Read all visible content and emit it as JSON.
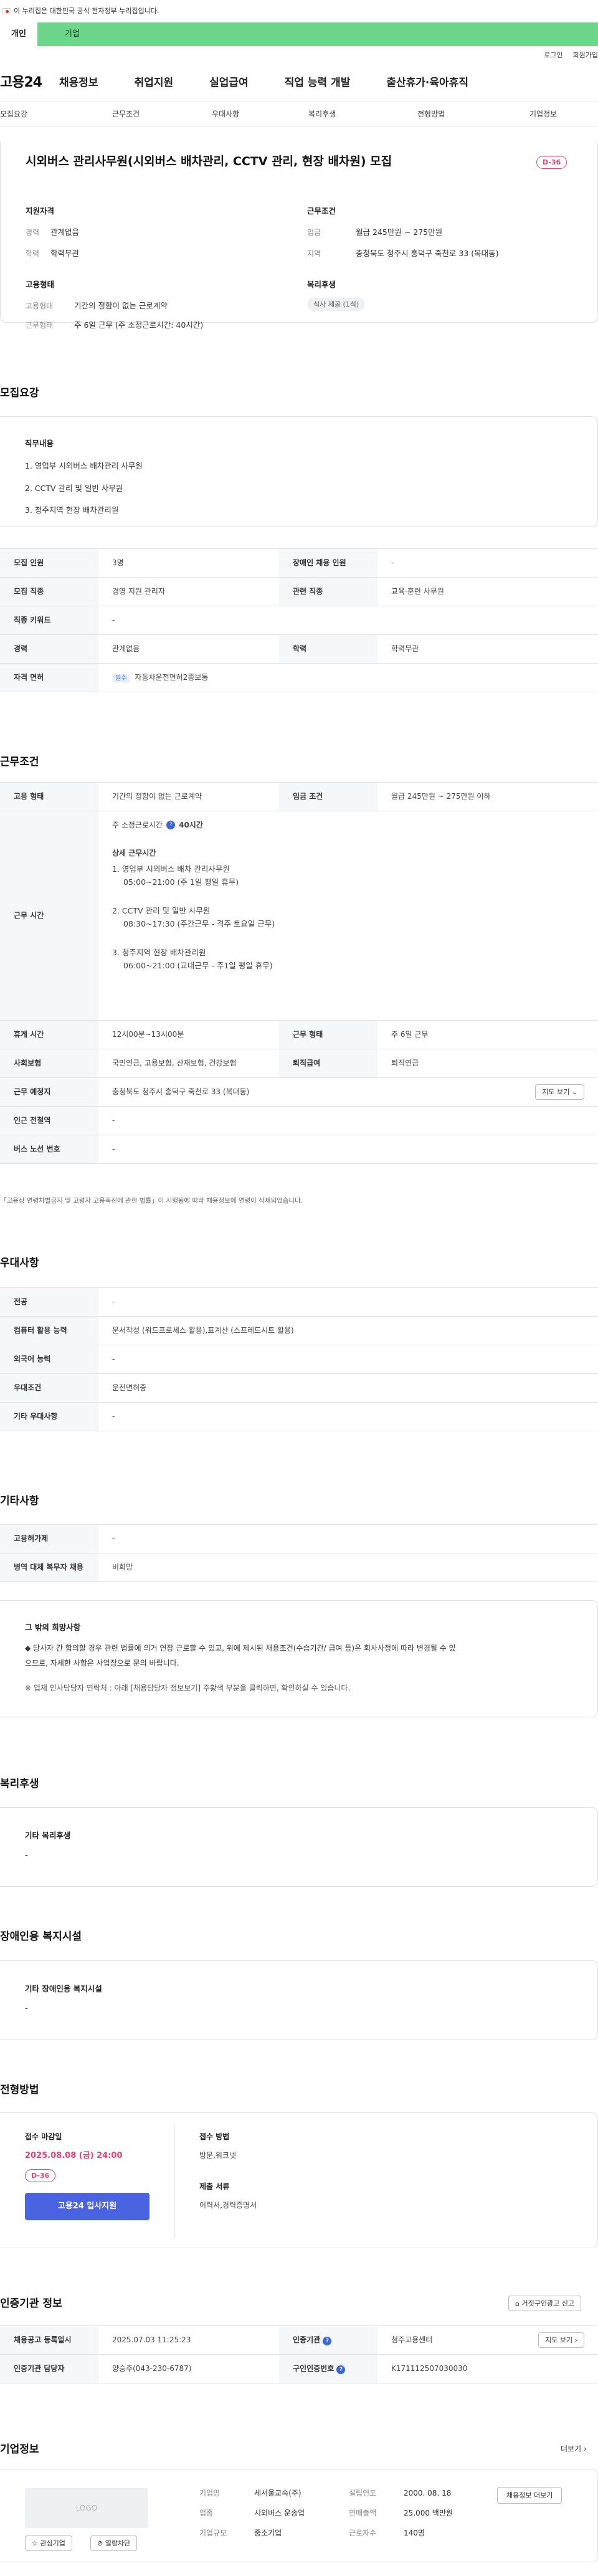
{
  "gov_banner": {
    "text": "이 누리집은 대한민국 공식 전자정부 누리집입니다."
  },
  "tabs": {
    "personal": "개인",
    "company": "기업"
  },
  "utility": {
    "login": "로그인",
    "join": "회원가입"
  },
  "gnb": {
    "logo": "고용24",
    "menu": [
      "채용정보",
      "취업지원",
      "실업급여",
      "직업 능력 개발",
      "출산휴가·육아휴직"
    ]
  },
  "anchors": [
    "모집요강",
    "근무조건",
    "우대사항",
    "복리후생",
    "전형방법",
    "기업정보"
  ],
  "summary": {
    "title": "시외버스 관리사무원(시외버스 배차관리, CCTV 관리, 현장 배차원) 모집",
    "dday": "D-36",
    "qual_head": "지원자격",
    "career_l": "경력",
    "career_v": "관계없음",
    "edu_l": "학력",
    "edu_v": "학력무관",
    "emp_head": "고용형태",
    "emp_l": "고용형태",
    "emp_v": "기간의 정함이 없는 근로계약",
    "work_l": "근무형태",
    "work_v": "주 6일 근무 (주 소정근로시간: 40시간)",
    "cond_head": "근무조건",
    "pay_l": "임금",
    "pay_v": "월급 245만원 ~ 275만원",
    "loc_l": "지역",
    "loc_v": "충청북도 청주시 흥덕구 죽천로 33 (복대동)",
    "welfare_head": "복리후생",
    "welfare_chip": "식사 제공 (1식)"
  },
  "recruit": {
    "title": "모집요강",
    "duty_head": "직무내용",
    "duties": [
      "1. 영업부 시외버스 배차관리 사무원",
      "2. CCTV 관리 및 일반 사무원",
      "3. 청주지역 현장 배차관리원"
    ],
    "rows": [
      {
        "k1": "모집 인원",
        "v1": "3명",
        "k2": "장애인 채용 인원",
        "v2": "-"
      },
      {
        "k1": "모집 직종",
        "v1": "경영 지원 관리자",
        "k2": "관련 직종",
        "v2": "교육·훈련 사무원"
      },
      {
        "k1": "직종 키워드",
        "v1": "-"
      },
      {
        "k1": "경력",
        "v1": "관계없음",
        "k2": "학력",
        "v2": "학력무관"
      },
      {
        "k1": "자격 면허",
        "v1": "자동차운전면허2종보통",
        "chip": "필수"
      }
    ]
  },
  "cond": {
    "title": "근무조건",
    "emp_k": "고용 형태",
    "emp_v": "기간의 정함이 없는 근로계약",
    "pay_k": "임금 조건",
    "pay_v": "월급 245만원 ~ 275만원 이하",
    "hours_k": "근무 시간",
    "hours_main": "주 소정근로시간",
    "hours_val": "40시간",
    "detail_head": "상세 근무시간",
    "detail": [
      "1. 영업부 시외버스 배차 관리사무원",
      "05:00~21:00 (주 1일 평일 휴무)",
      "2. CCTV 관리 및 일반 사무원",
      "08:30~17:30 (주간근무 - 격주 토요일 근무)",
      "3. 청주지역 현장 배차관리원",
      "06:00~21:00 (교대근무 - 주1일 평일 휴무)"
    ],
    "rest_k": "휴게 시간",
    "rest_v": "12시00분~13시00분",
    "form_k": "근무 형태",
    "form_v": "주 6일 근무",
    "ins_k": "사회보험",
    "ins_v": "국민연금, 고용보험, 산재보험, 건강보험",
    "ret_k": "퇴직급여",
    "ret_v": "퇴직연금",
    "place_k": "근무 예정지",
    "place_v": "충청북도 청주시 흥덕구 죽천로 33 (복대동)",
    "map_btn": "지도 보기",
    "sub_k": "인근 전철역",
    "sub_v": "-",
    "bus_k": "버스 노선 번호",
    "bus_v": "-",
    "note": "「고용상 연령차별금지 및 고령자 고용촉진에 관한 법률」이 시행됨에 따라 채용정보에 연령이 삭제되었습니다."
  },
  "pref": {
    "title": "우대사항",
    "rows": [
      {
        "k": "전공",
        "v": "-"
      },
      {
        "k": "컴퓨터 활용 능력",
        "v": "문서작성 (워드프로세스 활용),표계산 (스프레드시트 활용)"
      },
      {
        "k": "외국어 능력",
        "v": "-"
      },
      {
        "k": "우대조건",
        "v": "운전면허증"
      },
      {
        "k": "기타 우대사항",
        "v": "-"
      }
    ]
  },
  "etc": {
    "title": "기타사항",
    "rows": [
      {
        "k": "고용허가제",
        "v": "-"
      },
      {
        "k": "병역 대체 복무자 채용",
        "v": "비희망"
      }
    ],
    "box_head": "그 밖의 희망사항",
    "box_line1": "◆ 당사자 간 합의할 경우 관련 법률에 의거 연장 근로할 수 있고, 위에 제시된 채용조건(수습기간/ 급여 등)은 회사사정에 따라 변경될 수 있",
    "box_line2": "으므로, 자세한 사항은 사업장으로 문의 바랍니다.",
    "box_line3": "※ 업체 인사담당자 연락처 : 아래 [채용담당자 정보보기] 주황색 부분을 클릭하면, 확인하실 수 있습니다."
  },
  "welfare": {
    "title": "복리후생",
    "head": "기타 복리후생",
    "value": "-"
  },
  "disab": {
    "title": "장애인용 복지시설",
    "head": "기타 장애인용 복지시설",
    "value": "-"
  },
  "process": {
    "title": "전형방법",
    "deadline_l": "접수 마감일",
    "deadline_v": "2025.08.08 (금) 24:00",
    "dday": "D-36",
    "apply_btn": "고용24 입사지원",
    "method_l": "접수 방법",
    "method_v": "방문,워크넷",
    "docs_l": "제출 서류",
    "docs_v": "이력서,경력증명서"
  },
  "agency": {
    "title": "인증기관 정보",
    "report_btn": "거짓구인광고 신고",
    "reg_k": "채용공고 등록일시",
    "reg_v": "2025.07.03 11:25:23",
    "org_k": "인증기관",
    "org_v": "청주고용센터",
    "map_btn": "지도 보기",
    "mgr_k": "인증기관 담당자",
    "mgr_v": "양승주(043-230-6787)",
    "no_k": "구인인증번호",
    "no_v": "K171112507030030"
  },
  "company": {
    "title": "기업정보",
    "more": "더보기",
    "logo": "LOGO",
    "fav_btn": "관심기업",
    "block_btn": "열람차단",
    "name_k": "기업명",
    "name_v": "세서울교속(주)",
    "found_k": "설립연도",
    "found_v": "2000. 08. 18",
    "ind_k": "업종",
    "ind_v": "시외버스 운송업",
    "sales_k": "연매출액",
    "sales_v": "25,000 백만원",
    "size_k": "기업규모",
    "size_v": "중소기업",
    "emp_k": "근로자수",
    "emp_v": "140명",
    "jobs_btn": "채용정보 더보기"
  }
}
